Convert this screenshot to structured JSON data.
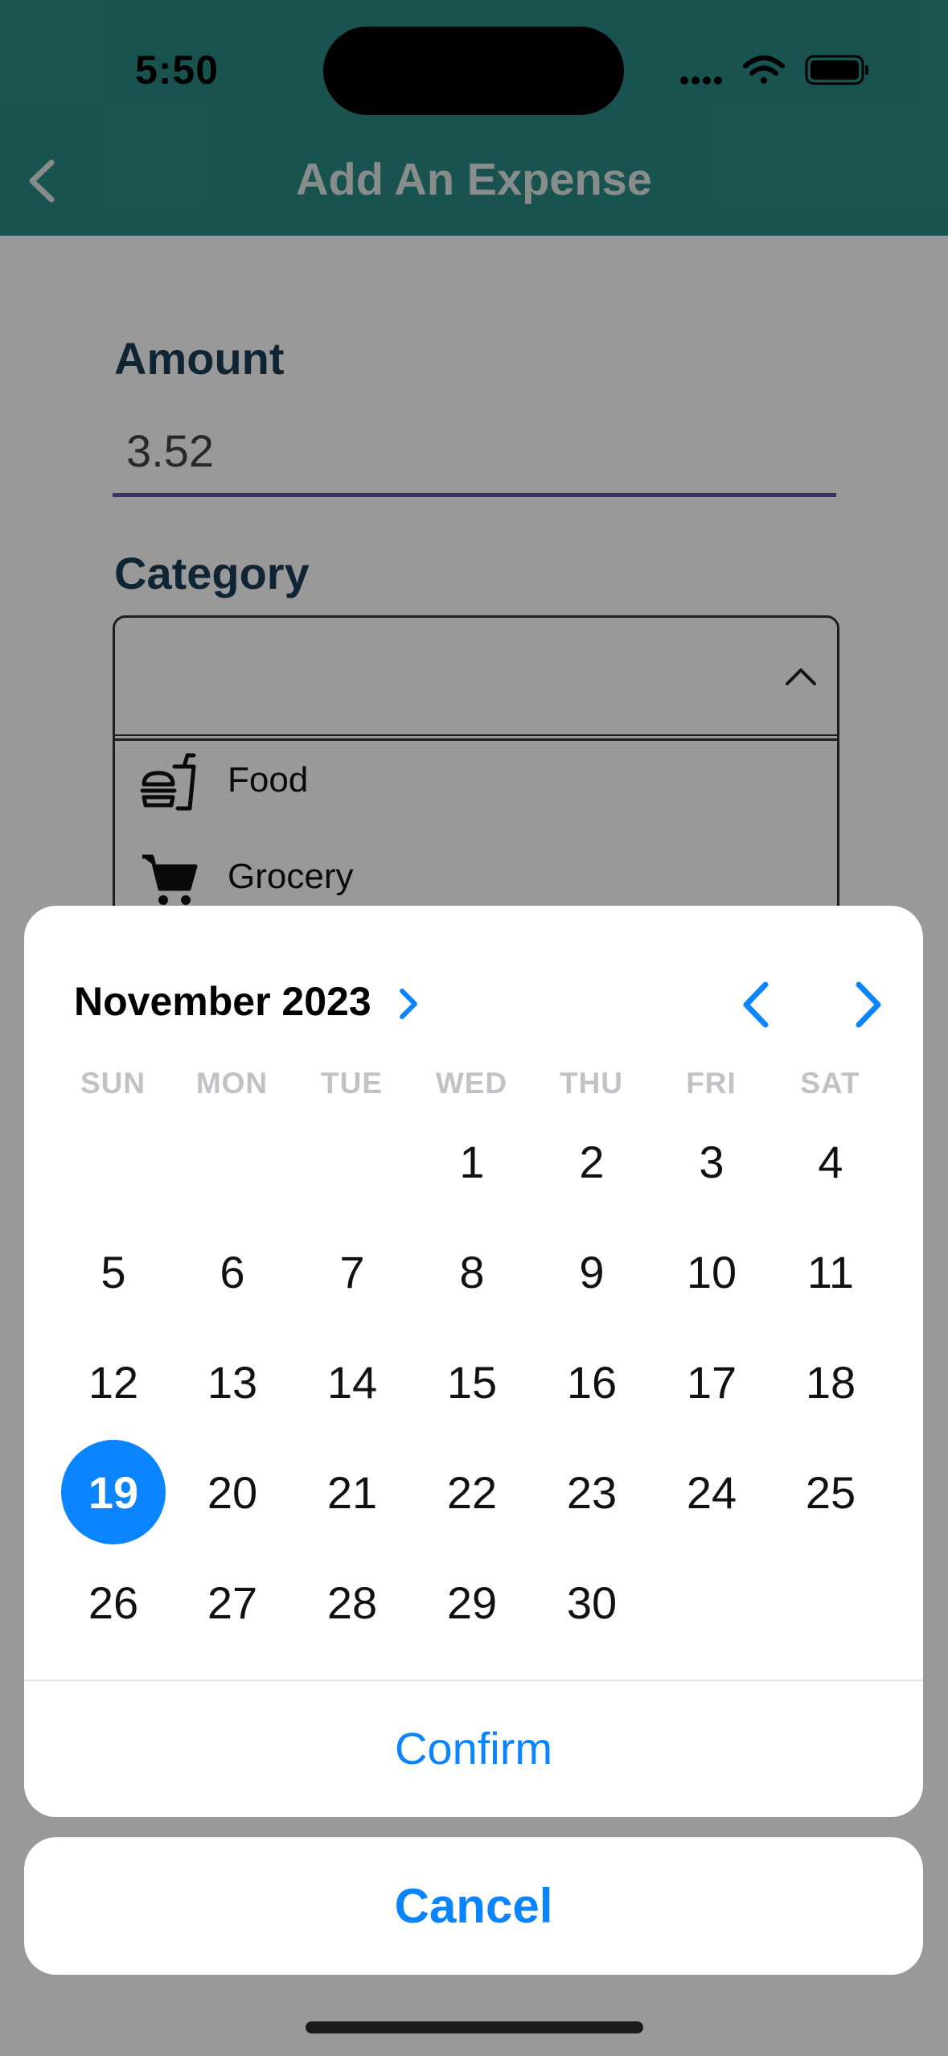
{
  "status_bar": {
    "time": "5:50"
  },
  "nav": {
    "title": "Add An Expense",
    "back_icon": "chevron-left-icon"
  },
  "form": {
    "amount_label": "Amount",
    "amount_value": "3.52",
    "category_label": "Category",
    "category_options": [
      {
        "label": "Food",
        "icon": "food-icon"
      },
      {
        "label": "Grocery",
        "icon": "cart-icon"
      }
    ]
  },
  "date_picker": {
    "month_label": "November 2023",
    "weekdays": [
      "SUN",
      "MON",
      "TUE",
      "WED",
      "THU",
      "FRI",
      "SAT"
    ],
    "first_weekday_index": 3,
    "days_in_month": 30,
    "selected_day": 19,
    "confirm_label": "Confirm",
    "cancel_label": "Cancel"
  },
  "colors": {
    "header": "#2b8a86",
    "accent": "#0a84ff",
    "label": "#1c3e57",
    "underline": "#6752b5"
  }
}
